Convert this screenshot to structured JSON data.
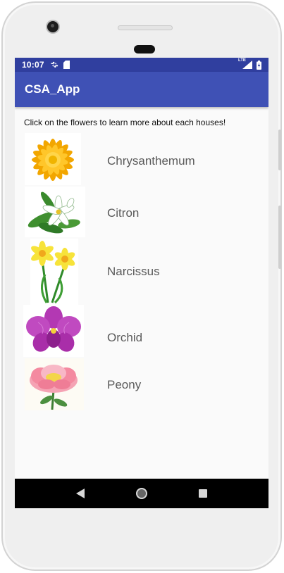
{
  "status": {
    "time": "10:07",
    "network": "LTE"
  },
  "app": {
    "title": "CSA_App"
  },
  "intro_text": "Click on the flowers to learn more about each houses!",
  "flowers": [
    {
      "name": "Chrysanthemum"
    },
    {
      "name": "Citron"
    },
    {
      "name": "Narcissus"
    },
    {
      "name": "Orchid"
    },
    {
      "name": "Peony"
    }
  ],
  "colors": {
    "status_bar": "#303f9f",
    "app_bar": "#3f51b5",
    "nav_bar": "#000000"
  }
}
